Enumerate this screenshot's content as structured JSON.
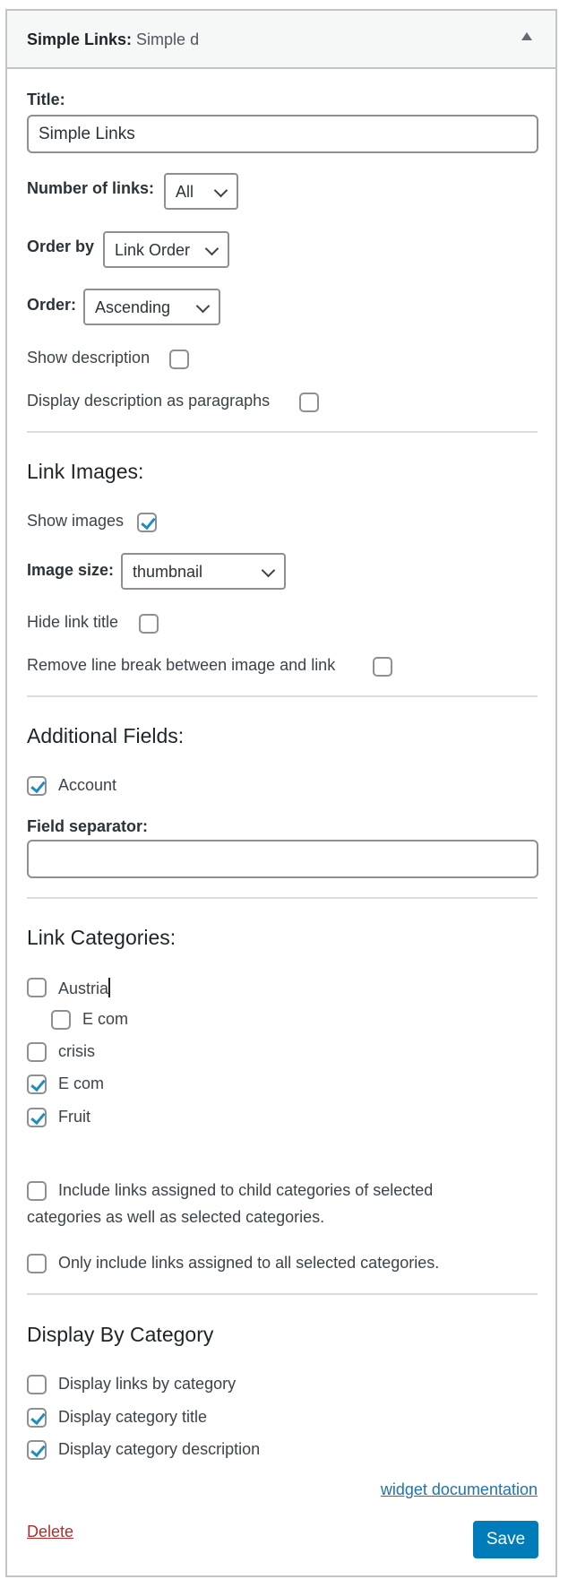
{
  "header": {
    "widget_name": "Simple Links:",
    "widget_subtitle": "Simple d"
  },
  "form": {
    "title_label": "Title:",
    "title_value": "Simple Links",
    "number_of_links_label": "Number of links:",
    "number_of_links_value": "All",
    "order_by_label": "Order by",
    "order_by_value": "Link Order",
    "order_label": "Order:",
    "order_value": "Ascending",
    "show_description_label": "Show description",
    "show_description_checked": false,
    "description_paragraphs_label": "Display description as paragraphs",
    "description_paragraphs_checked": false
  },
  "link_images": {
    "heading": "Link Images:",
    "show_images_label": "Show images",
    "show_images_checked": true,
    "image_size_label": "Image size:",
    "image_size_value": "thumbnail",
    "hide_link_title_label": "Hide link title",
    "hide_link_title_checked": false,
    "remove_line_break_label": "Remove line break between image and link",
    "remove_line_break_checked": false
  },
  "additional_fields": {
    "heading": "Additional Fields:",
    "fields": [
      {
        "label": "Account",
        "checked": true
      }
    ],
    "field_separator_label": "Field separator:",
    "field_separator_value": ""
  },
  "link_categories": {
    "heading": "Link Categories:",
    "categories": [
      {
        "label": "Austria",
        "checked": false,
        "level": 0
      },
      {
        "label": "E com",
        "checked": false,
        "level": 1
      },
      {
        "label": "crisis",
        "checked": false,
        "level": 0
      },
      {
        "label": "E com",
        "checked": true,
        "level": 0
      },
      {
        "label": "Fruit",
        "checked": true,
        "level": 0
      }
    ],
    "include_child_line1": "Include links assigned to child categories of selected",
    "include_child_line2": "categories as well as selected categories.",
    "include_child_checked": false,
    "only_all_label": "Only include links assigned to all selected categories.",
    "only_all_checked": false
  },
  "display_by_category": {
    "heading": "Display By Category",
    "options": [
      {
        "label": "Display links by category",
        "checked": false
      },
      {
        "label": "Display category title",
        "checked": true
      },
      {
        "label": "Display category description",
        "checked": true
      }
    ]
  },
  "footer": {
    "documentation_link": "widget documentation",
    "delete_label": "Delete",
    "save_label": "Save"
  },
  "colors": {
    "accent": "#007cba",
    "check": "#1e8cbe",
    "delete": "#b32d2e",
    "link": "#2271b1",
    "border": "#c3c4c7",
    "header_bg": "#f6f7f7"
  }
}
